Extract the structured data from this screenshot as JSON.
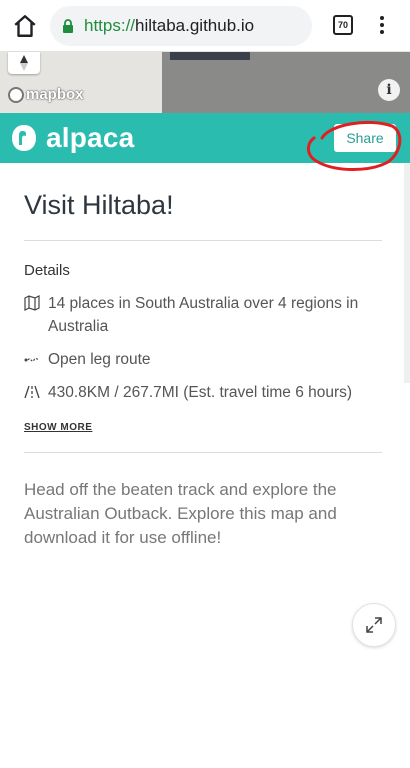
{
  "browser": {
    "url_scheme": "https://",
    "url_host": "hiltaba.github.io",
    "tab_count": "70",
    "icons": [
      "home-icon",
      "lock-icon",
      "tabs-icon",
      "menu-icon"
    ]
  },
  "map": {
    "attribution": "mapbox",
    "info_label": "i",
    "icons": [
      "compass-icon",
      "info-icon"
    ]
  },
  "header": {
    "brand": "alpaca",
    "share_label": "Share",
    "color": "#2bbcb0",
    "annotation_color": "#e02020"
  },
  "main": {
    "title": "Visit Hiltaba!",
    "details_heading": "Details",
    "details": [
      {
        "icon": "map-icon",
        "text": "14 places in South Australia over 4 regions in Australia"
      },
      {
        "icon": "route-icon",
        "text": "Open leg route"
      },
      {
        "icon": "road-icon",
        "text": "430.8KM / 267.7MI (Est. travel time 6 hours)"
      }
    ],
    "show_more": "SHOW MORE",
    "description": "Head off the beaten track and explore the Australian Outback. Explore this map and download it for use offline!",
    "expand_icon": "expand-icon"
  }
}
